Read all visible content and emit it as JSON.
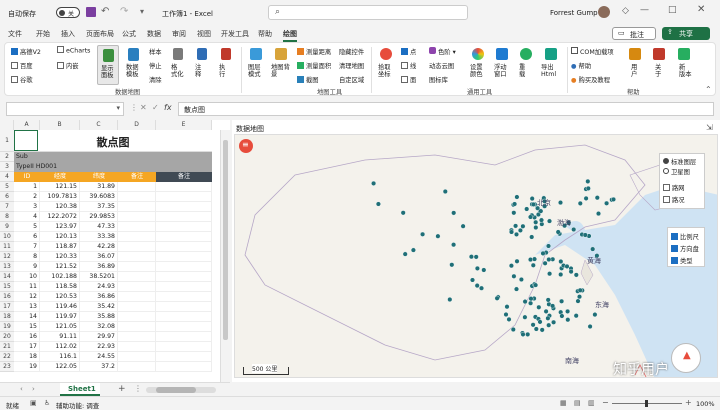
{
  "titlebar": {
    "autosave_label": "自动保存",
    "autosave_state": "关",
    "doc_title": "工作簿1 - Excel",
    "search_placeholder": "",
    "user_name": "Forrest Gump"
  },
  "tabs": [
    "文件",
    "开始",
    "插入",
    "页面布局",
    "公式",
    "数据",
    "审阅",
    "视图",
    "开发工具",
    "帮助",
    "绘图"
  ],
  "active_tab": "绘图",
  "comment_button": "批注",
  "share_button": "共享",
  "ribbon": {
    "left_checks": [
      {
        "label": "高德V2",
        "checked": true
      },
      {
        "label": "eCharts",
        "checked": false
      },
      {
        "label": "百度",
        "checked": false
      },
      {
        "label": "内嵌",
        "checked": false
      },
      {
        "label": "谷歌",
        "checked": false
      }
    ],
    "show_panel_label": "显示\n面板",
    "data_template_label": "数据\n模板",
    "sample_label": "样本",
    "stop_label": "停止",
    "clear_label": "清除",
    "format_label": "格\n式化",
    "annotate_label": "注\n释",
    "execute_label": "执\n行",
    "group_data_map": "数据地图",
    "map_mode_label": "图层\n模式",
    "map_bg_label": "地图背\n景",
    "measure_distance": "测量距离",
    "measure_area": "测量面积",
    "screenshot_label": "截图",
    "hide_controls": "隐藏控件",
    "clear_map": "清理地图",
    "custom_area": "自定区域",
    "group_map_tools": "地图工具",
    "pick_coords_label": "拾取\n坐标",
    "point_label": "点",
    "line_label": "线",
    "circle_label": "面",
    "color_label": "色阶",
    "dynamic_label": "动态云图",
    "icon_lib_label": "图标库",
    "settings_color_label": "设置\n颜色",
    "float_window_label": "浮动\n窗口",
    "refresh_label": "重\n载",
    "export_html_label": "导出\nHtml",
    "group_general": "通用工具",
    "com_addin": "COM加载项",
    "help_item": "帮助",
    "buy_label": "购买及教程",
    "user_label": "用\n户",
    "about_label": "关\n于",
    "new_version_label": "新\n版本",
    "group_help": "帮助"
  },
  "formula_bar": {
    "name_box": "",
    "fx": "fx",
    "content": "散点图"
  },
  "sheet": {
    "columns": [
      "A",
      "B",
      "C",
      "D",
      "E"
    ],
    "title": "散点图",
    "sub": "Sub",
    "type_line": "TypeII HD001",
    "headers": [
      "ID",
      "经度",
      "纬度",
      "备注",
      "备注"
    ],
    "rows": [
      [
        "1",
        "121.15",
        "31.89"
      ],
      [
        "2",
        "109.7813",
        "39.6083"
      ],
      [
        "3",
        "120.38",
        "37.35"
      ],
      [
        "4",
        "122.2072",
        "29.9853"
      ],
      [
        "5",
        "123.97",
        "47.33"
      ],
      [
        "6",
        "120.13",
        "33.38"
      ],
      [
        "7",
        "118.87",
        "42.28"
      ],
      [
        "8",
        "120.33",
        "36.07"
      ],
      [
        "9",
        "121.52",
        "36.89"
      ],
      [
        "10",
        "102.188",
        "38.5201"
      ],
      [
        "11",
        "118.58",
        "24.93"
      ],
      [
        "12",
        "120.53",
        "36.86"
      ],
      [
        "13",
        "119.46",
        "35.42"
      ],
      [
        "14",
        "119.97",
        "35.88"
      ],
      [
        "15",
        "121.05",
        "32.08"
      ],
      [
        "16",
        "91.11",
        "29.97"
      ],
      [
        "17",
        "112.02",
        "22.93"
      ],
      [
        "18",
        "116.1",
        "24.55"
      ],
      [
        "19",
        "122.05",
        "37.2"
      ]
    ],
    "sheet_tab": "Sheet1"
  },
  "map": {
    "panel_title": "数据地图",
    "layer_options": [
      {
        "label": "标准图层",
        "selected": true
      },
      {
        "label": "卫星图",
        "selected": false
      }
    ],
    "overlay_options": [
      {
        "label": "路网",
        "checked": false
      },
      {
        "label": "路况",
        "checked": false
      }
    ],
    "control_options": [
      {
        "label": "比例尺",
        "checked": true
      },
      {
        "label": "方向盘",
        "checked": true
      },
      {
        "label": "类型",
        "checked": true
      }
    ],
    "labels": [
      "北京",
      "渤海",
      "黄海",
      "东海",
      "南海"
    ],
    "scale_text": "500 公里",
    "watermark": "知乎用户",
    "point_color": "#1f6f77"
  },
  "status": {
    "ready": "就绪",
    "accessibility": "辅助功能: 调查",
    "zoom": "100%"
  }
}
